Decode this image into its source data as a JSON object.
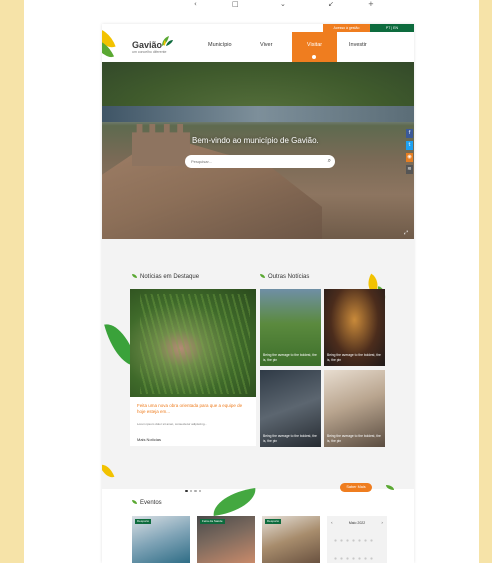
{
  "colors": {
    "accent": "#ef7d1f",
    "brand_green": "#0d6b3d",
    "leaf_green": "#5aa832",
    "leaf_yellow": "#f2c200",
    "frame": "#f6e3a8"
  },
  "toolbar": {
    "icons": [
      "chevron-left-icon",
      "square-icon",
      "chevron-down-icon",
      "arrow-icon",
      "plus-icon"
    ]
  },
  "header": {
    "logo_name": "Gavião",
    "logo_tagline": "um concelho diferente",
    "topbar_left": "Acesso à gestão",
    "topbar_right": "PT | EN",
    "nav": [
      "Município",
      "Viver",
      "Visitar",
      "Investir"
    ],
    "active_nav": "Visitar"
  },
  "hero": {
    "title": "Bem-vindo ao município de Gavião.",
    "search_placeholder": "Pesquisar...",
    "social_icons": [
      "facebook-icon",
      "twitter-icon",
      "instagram-icon",
      "rss-icon"
    ],
    "slide_count": 3,
    "active_slide": 1
  },
  "news": {
    "featured_title": "Notícias em Destaque",
    "others_title": "Outras Notícias",
    "featured": {
      "headline": "Feita uma nova obra orientada para que a equipe de hoje esteja em...",
      "description": "Lorem ipsum dolor sit amet, consectetur adipiscing...",
      "more_label": "Mais Notícias"
    },
    "cards": [
      {
        "caption": "Being the average to the boldest, the is, the pin"
      },
      {
        "caption": "Being the average to the boldest, the is, the pin"
      },
      {
        "caption": "Being the average to the boldest, the is, the pin"
      },
      {
        "caption": "Being the average to the boldest, the is, the pin"
      }
    ],
    "see_more_button": "Saber Mais",
    "page_count": 4,
    "active_page": 0
  },
  "events": {
    "title": "Eventos",
    "tags": [
      "Desporto",
      "Feira da Saúde",
      "Desporto"
    ],
    "calendar_month": "Maio 2022"
  }
}
